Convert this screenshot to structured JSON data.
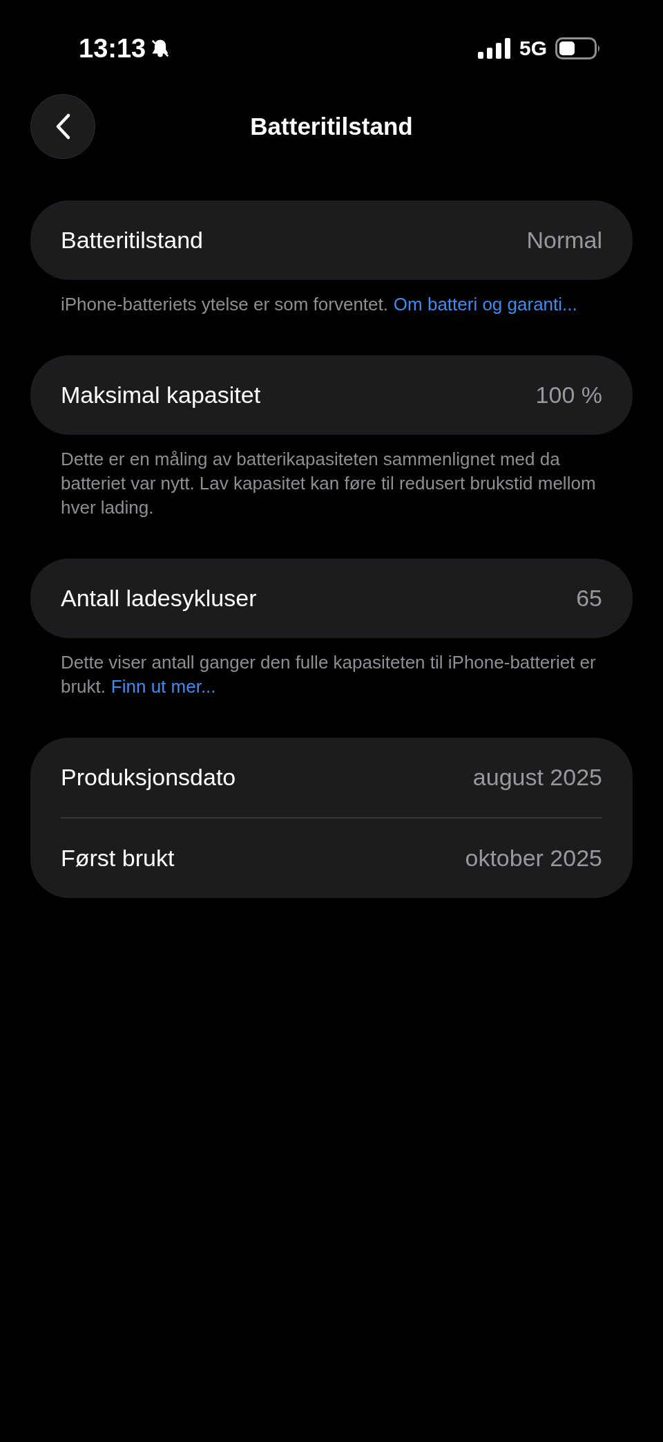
{
  "status_bar": {
    "time": "13:13",
    "network": "5G"
  },
  "nav": {
    "title": "Batteritilstand"
  },
  "sections": [
    {
      "rows": [
        {
          "label": "Batteritilstand",
          "value": "Normal"
        }
      ],
      "footer": {
        "text": "iPhone-batteriets ytelse er som forventet.",
        "link": "Om batteri og garanti..."
      }
    },
    {
      "rows": [
        {
          "label": "Maksimal kapasitet",
          "value": "100 %"
        }
      ],
      "footer": {
        "text": "Dette er en måling av batterikapasiteten sammenlignet med da batteriet var nytt. Lav kapasitet kan føre til redusert brukstid mellom hver lading."
      }
    },
    {
      "rows": [
        {
          "label": "Antall ladesykluser",
          "value": "65"
        }
      ],
      "footer": {
        "text": "Dette viser antall ganger den fulle kapasiteten til iPhone-batteriet er brukt.",
        "link": "Finn ut mer..."
      }
    },
    {
      "rows": [
        {
          "label": "Produksjonsdato",
          "value": "august 2025"
        },
        {
          "label": "Først brukt",
          "value": "oktober 2025"
        }
      ]
    }
  ]
}
